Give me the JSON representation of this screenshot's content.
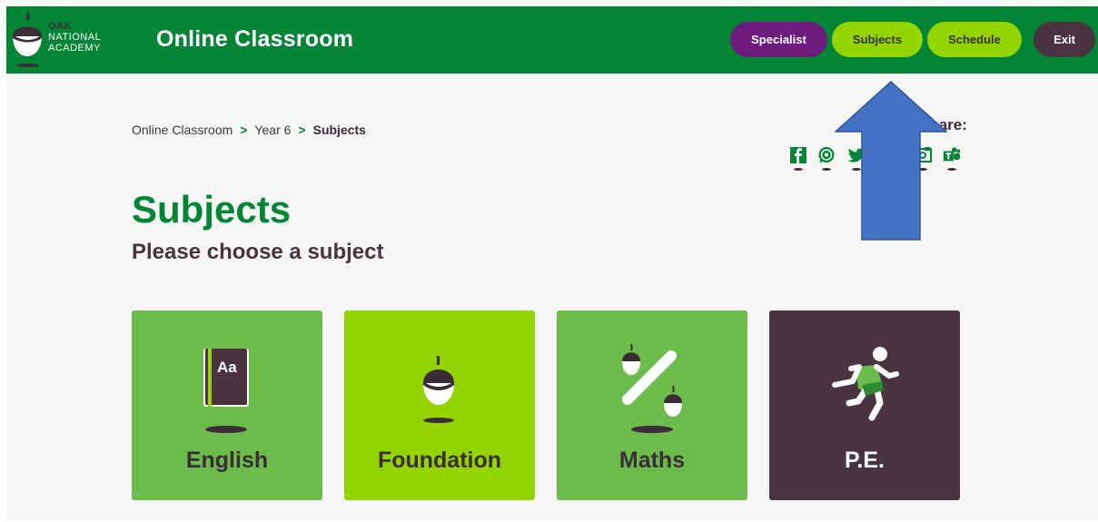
{
  "header": {
    "logo_line1": "OAK",
    "logo_line2": "NATIONAL",
    "logo_line3": "ACADEMY",
    "title": "Online Classroom",
    "nav": {
      "specialist": "Specialist",
      "subjects": "Subjects",
      "schedule": "Schedule",
      "exit": "Exit"
    }
  },
  "breadcrumb": {
    "items": [
      "Online Classroom",
      "Year 6"
    ],
    "current": "Subjects"
  },
  "share": {
    "label": "Share:",
    "icons": [
      "facebook-icon",
      "whatsapp-icon",
      "twitter-icon",
      "email-icon",
      "google-classroom-icon",
      "teams-icon"
    ]
  },
  "page": {
    "title": "Subjects",
    "subtitle": "Please choose a subject"
  },
  "subjects": [
    {
      "label": "English",
      "icon": "book-icon",
      "color": "#6cbc4c",
      "text_color": "#3a2d37"
    },
    {
      "label": "Foundation",
      "icon": "acorn-icon",
      "color": "#94d400",
      "text_color": "#3a2d37"
    },
    {
      "label": "Maths",
      "icon": "percent-icon",
      "color": "#6cbc4c",
      "text_color": "#3a2d37"
    },
    {
      "label": "P.E.",
      "icon": "runner-icon",
      "color": "#4a3440",
      "text_color": "#ffffff"
    }
  ],
  "colors": {
    "brand_green": "#038536",
    "lime": "#94d400",
    "plum": "#4a3440",
    "purple": "#6e1b7e",
    "annotation_arrow": "#4472c4"
  }
}
